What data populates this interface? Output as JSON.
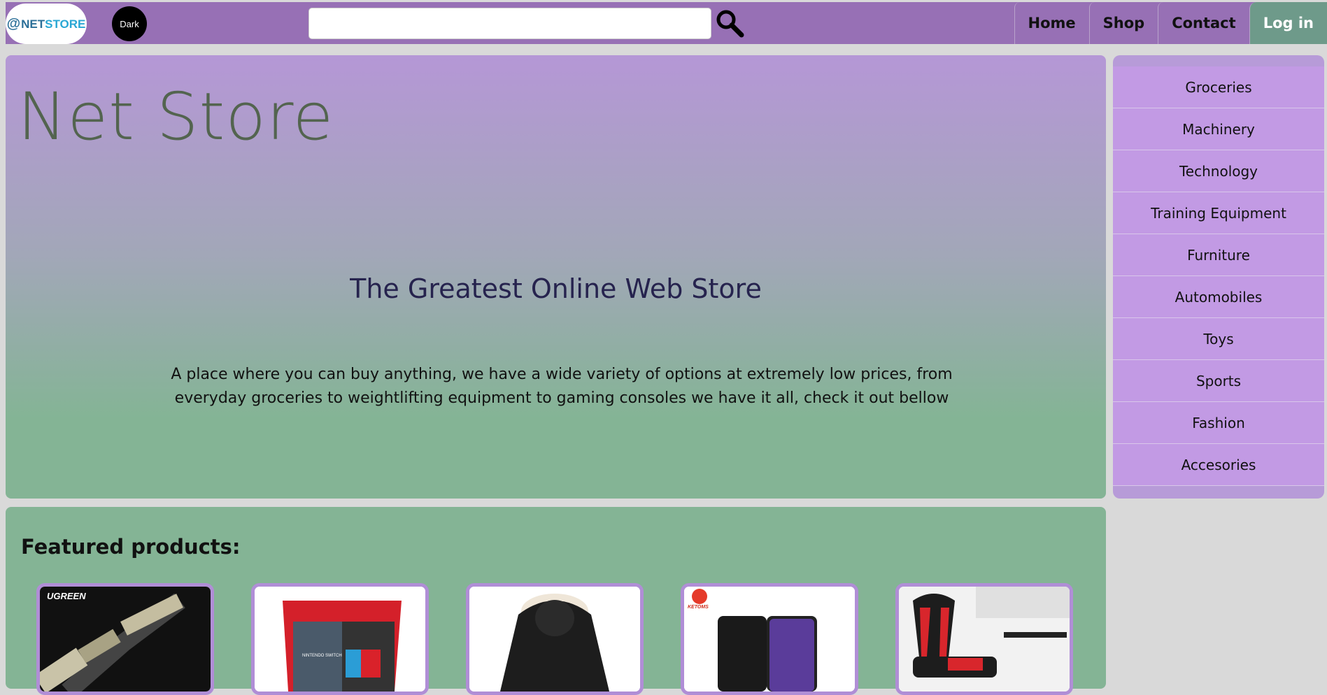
{
  "header": {
    "logo_at": "@",
    "logo_net": "NET",
    "logo_store": "STORE",
    "dark_label": "Dark",
    "search_placeholder": "",
    "nav": [
      {
        "label": "Home"
      },
      {
        "label": "Shop"
      },
      {
        "label": "Contact"
      },
      {
        "label": "Log in"
      }
    ]
  },
  "hero": {
    "title": "Net Store",
    "subtitle": "The Greatest Online Web Store",
    "description": "A place where you can buy anything, we have a wide variety of options at extremely low prices, from everyday groceries to weightlifting equipment to gaming consoles we have it all, check it out bellow"
  },
  "categories": [
    {
      "label": "Groceries"
    },
    {
      "label": "Machinery"
    },
    {
      "label": "Technology"
    },
    {
      "label": "Training Equipment"
    },
    {
      "label": "Furniture"
    },
    {
      "label": "Automobiles"
    },
    {
      "label": "Toys"
    },
    {
      "label": "Sports"
    },
    {
      "label": "Fashion"
    },
    {
      "label": "Accesories"
    }
  ],
  "featured": {
    "title": "Featured products:",
    "products": [
      {
        "name": "hdmi-cable",
        "brand": "UGREEN"
      },
      {
        "name": "nintendo-switch",
        "brand": "NINTENDO SWITCH"
      },
      {
        "name": "winter-jacket"
      },
      {
        "name": "smartphone",
        "brand": "KETOMS"
      },
      {
        "name": "gaming-chair"
      }
    ]
  },
  "colors": {
    "nav_bg": "#9770b5",
    "login_bg": "#6e9a8a",
    "category_bg": "#c29ae4",
    "featured_bg": "#84b495",
    "card_border": "#b08ed6"
  }
}
